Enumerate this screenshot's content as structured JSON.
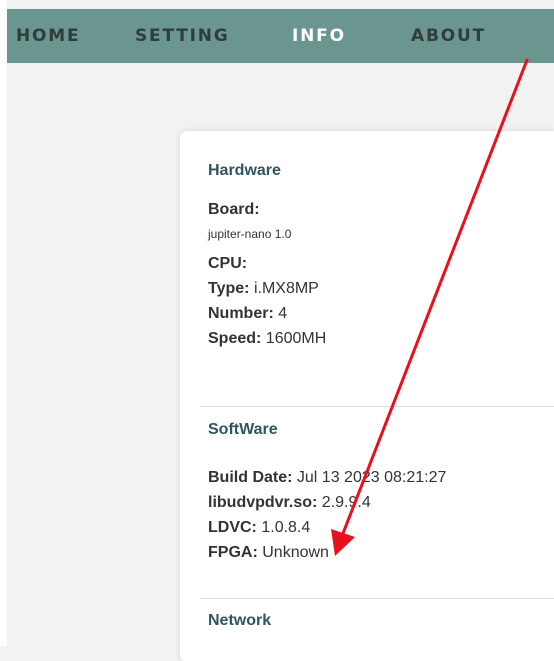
{
  "nav": {
    "items": [
      {
        "label": "HOME"
      },
      {
        "label": "SETTING"
      },
      {
        "label": "INFO"
      },
      {
        "label": "ABOUT"
      }
    ],
    "active": "INFO"
  },
  "hardware": {
    "title": "Hardware",
    "board_label": "Board:",
    "board_value": "jupiter-nano 1.0",
    "cpu_label": "CPU:",
    "type_label": "Type:",
    "type_value": "i.MX8MP",
    "number_label": "Number:",
    "number_value": "4",
    "speed_label": "Speed:",
    "speed_value": "1600MH"
  },
  "software": {
    "title": "SoftWare",
    "build_label": "Build Date:",
    "build_value": "Jul 13 2023 08:21:27",
    "lib_label": "libudvpdvr.so:",
    "lib_value": "2.9.9.4",
    "ldvc_label": "LDVC:",
    "ldvc_value": "1.0.8.4",
    "fpga_label": "FPGA:",
    "fpga_value": "Unknown"
  },
  "network": {
    "title": "Network"
  },
  "colors": {
    "nav_bg": "#6b958f",
    "nav_text": "#2f3d3b",
    "nav_active": "#ffffff",
    "section_title": "#2f5660",
    "annotation_arrow": "#e8101a"
  }
}
